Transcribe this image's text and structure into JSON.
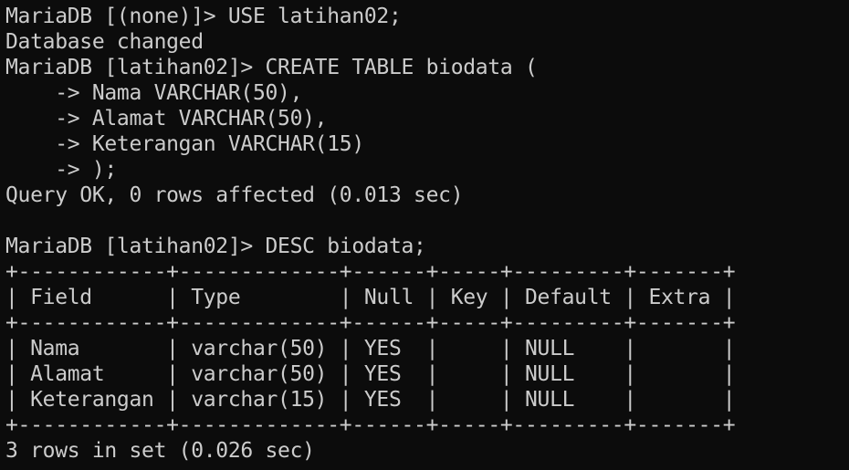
{
  "terminal": {
    "lines": [
      "MariaDB [(none)]> USE latihan02;",
      "Database changed",
      "MariaDB [latihan02]> CREATE TABLE biodata (",
      "    -> Nama VARCHAR(50),",
      "    -> Alamat VARCHAR(50),",
      "    -> Keterangan VARCHAR(15)",
      "    -> );",
      "Query OK, 0 rows affected (0.013 sec)",
      "",
      "MariaDB [latihan02]> DESC biodata;",
      "+------------+-------------+------+-----+---------+-------+",
      "| Field      | Type        | Null | Key | Default | Extra |",
      "+------------+-------------+------+-----+---------+-------+",
      "| Nama       | varchar(50) | YES  |     | NULL    |       |",
      "| Alamat     | varchar(50) | YES  |     | NULL    |       |",
      "| Keterangan | varchar(15) | YES  |     | NULL    |       |",
      "+------------+-------------+------+-----+---------+-------+",
      "3 rows in set (0.026 sec)"
    ]
  },
  "colors": {
    "background": "#0c0c0c",
    "foreground": "#cccccc"
  }
}
